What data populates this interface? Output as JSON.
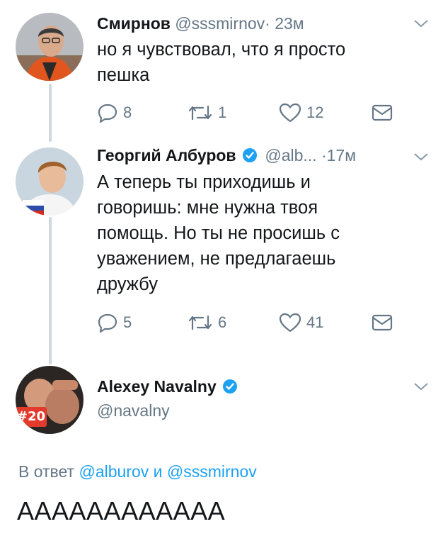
{
  "tweets": [
    {
      "name": "Смирнов",
      "handle": "@sssmirnov",
      "separator": "·",
      "time": "23м",
      "text_lines": [
        "но я чувствовал, что я просто",
        "пешка"
      ],
      "replies": "8",
      "retweets": "1",
      "likes": "12"
    },
    {
      "name": "Георгий Албуров",
      "handle": "@alb...",
      "separator": "·",
      "time": "17м",
      "verified": true,
      "text_lines": [
        "А теперь ты приходишь и",
        "говоришь: мне нужна твоя",
        "помощь. Но ты не просишь с",
        "уважением, не предлагаешь",
        "дружбу"
      ],
      "replies": "5",
      "retweets": "6",
      "likes": "41"
    }
  ],
  "main_tweet": {
    "name": "Alexey Navalny",
    "handle": "@navalny",
    "verified": true,
    "avatar_badge": "#20",
    "reply_prefix": "В ответ",
    "reply_mention_1": "@alburov",
    "reply_conjunction": "и",
    "reply_mention_2": "@sssmirnov",
    "text": "АААААААААААА"
  },
  "colors": {
    "accent": "#1da1f2",
    "secondary_text": "#657786",
    "thread_line": "#cfd9de"
  },
  "icons": [
    "reply-icon",
    "retweet-icon",
    "like-icon",
    "direct-message-icon",
    "chevron-down-icon",
    "verified-icon"
  ]
}
